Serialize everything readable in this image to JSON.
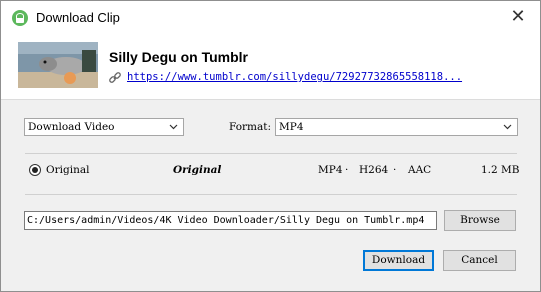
{
  "window": {
    "title": "Download Clip",
    "close_glyph": "✕",
    "icon": "app-logo-icon"
  },
  "clip": {
    "title": "Silly Degu on Tumblr",
    "url": "https://www.tumblr.com/sillydegu/729277328655581​18...",
    "thumbnail": "degu-thumbnail"
  },
  "options": {
    "download_type": "Download Video",
    "format_label": "Format:",
    "format_value": "MP4"
  },
  "quality": {
    "option_label": "Original",
    "name": "Original",
    "container": "MP4",
    "video_codec": "H264",
    "audio_codec": "AAC",
    "separator": "·",
    "size": "1.2 MB",
    "selected": true
  },
  "save": {
    "path": "C:/Users/admin/Videos/4K Video Downloader/Silly Degu on Tumblr.mp4",
    "browse_label": "Browse"
  },
  "actions": {
    "download_label": "Download",
    "cancel_label": "Cancel"
  },
  "colors": {
    "link": "#0000cc",
    "accent": "#0078d7",
    "app_icon": "#5cb85c"
  }
}
